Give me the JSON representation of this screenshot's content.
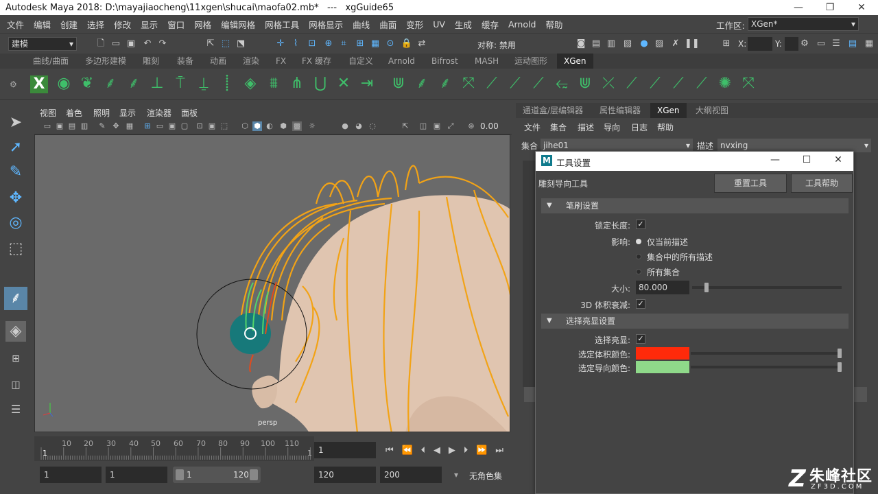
{
  "window": {
    "title": "Autodesk Maya 2018: D:\\mayajiaocheng\\11xgen\\shucai\\maofa02.mb*   ---   xgGuide65"
  },
  "menubar": {
    "items": [
      "文件",
      "编辑",
      "创建",
      "选择",
      "修改",
      "显示",
      "窗口",
      "网格",
      "编辑网格",
      "网格工具",
      "网格显示",
      "曲线",
      "曲面",
      "变形",
      "UV",
      "生成",
      "缓存",
      "Arnold",
      "帮助"
    ],
    "workspace_label": "工作区:",
    "workspace_value": "XGen*"
  },
  "statusline": {
    "mode": "建模",
    "symmetry": "对称: 禁用",
    "x_label": "X:",
    "y_label": "Y:"
  },
  "shelf": {
    "tabs": [
      "曲线/曲面",
      "多边形建模",
      "雕刻",
      "装备",
      "动画",
      "渲染",
      "FX",
      "FX 缓存",
      "自定义",
      "Arnold",
      "Bifrost",
      "MASH",
      "运动图形",
      "XGen"
    ],
    "active_tab": "XGen"
  },
  "viewport": {
    "menu": [
      "视图",
      "着色",
      "照明",
      "显示",
      "渲染器",
      "面板"
    ],
    "field_value": "0.00",
    "camera_label": "persp"
  },
  "timeline": {
    "ticks": [
      "1",
      "10",
      "20",
      "30",
      "40",
      "50",
      "60",
      "70",
      "80",
      "90",
      "100",
      "110",
      "1"
    ],
    "current_frame": "1",
    "range_start": "1",
    "range_start_inner": "1",
    "slider_start": "1",
    "slider_end": "120",
    "range_end_inner": "120",
    "range_end": "200",
    "char_set": "无角色集"
  },
  "right_panel": {
    "tabs": [
      "通道盒/层编辑器",
      "属性编辑器",
      "XGen",
      "大纲视图"
    ],
    "active_tab": "XGen",
    "menu": [
      "文件",
      "集合",
      "描述",
      "导向",
      "日志",
      "帮助"
    ],
    "collection_label": "集合",
    "collection_value": "jihe01",
    "description_label": "描述",
    "description_value": "nvxing"
  },
  "dialog": {
    "title": "工具设置",
    "tool_name": "雕刻导向工具",
    "reset_button": "重置工具",
    "help_button": "工具帮助",
    "brush_section": "笔刷设置",
    "lock_length_label": "锁定长度:",
    "affect_label": "影响:",
    "affect_options": [
      "仅当前描述",
      "集合中的所有描述",
      "所有集合"
    ],
    "size_label": "大小:",
    "size_value": "80.000",
    "falloff_label": "3D 体积衰减:",
    "highlight_section": "选择亮显设置",
    "highlight_label": "选择亮显:",
    "volume_color_label": "选定体积颜色:",
    "guide_color_label": "选定导向颜色:",
    "volume_color": "#ff2a0a",
    "guide_color": "#8fd98a"
  },
  "watermark": {
    "brand": "朱峰社区",
    "domain": "ZF3D.COM"
  }
}
